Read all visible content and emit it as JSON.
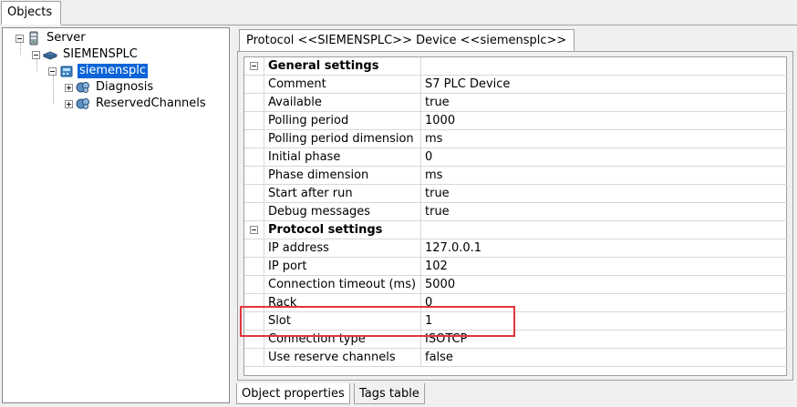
{
  "top_tab": {
    "label": "Objects"
  },
  "tree": {
    "nodes": [
      {
        "label": "Server",
        "expanded": true
      },
      {
        "label": "SIEMENSPLC",
        "expanded": true
      },
      {
        "label": "siemensplc",
        "expanded": true,
        "selected": true
      },
      {
        "label": "Diagnosis",
        "expanded": false
      },
      {
        "label": "ReservedChannels",
        "expanded": false
      }
    ]
  },
  "protocol_tab": {
    "label": "Protocol <<SIEMENSPLC>> Device <<siemensplc>>"
  },
  "properties": {
    "general_header": "General settings",
    "general": [
      {
        "name": "Comment",
        "value": "S7 PLC Device"
      },
      {
        "name": "Available",
        "value": "true"
      },
      {
        "name": "Polling period",
        "value": "1000"
      },
      {
        "name": "Polling period dimension",
        "value": "ms"
      },
      {
        "name": "Initial phase",
        "value": "0"
      },
      {
        "name": "Phase dimension",
        "value": "ms"
      },
      {
        "name": "Start after run",
        "value": "true"
      },
      {
        "name": "Debug messages",
        "value": "true"
      }
    ],
    "protocol_header": "Protocol settings",
    "protocol": [
      {
        "name": "IP address",
        "value": "127.0.0.1"
      },
      {
        "name": "IP port",
        "value": "102"
      },
      {
        "name": "Connection timeout (ms)",
        "value": "5000"
      },
      {
        "name": "Rack",
        "value": "0"
      },
      {
        "name": "Slot",
        "value": "1"
      },
      {
        "name": "Connection type",
        "value": "ISOTCP"
      },
      {
        "name": "Use reserve channels",
        "value": "false"
      }
    ]
  },
  "bottom_tabs": [
    {
      "label": "Object properties",
      "active": true
    },
    {
      "label": "Tags table",
      "active": false
    }
  ],
  "colors": {
    "selection": "#0a64d8",
    "highlight_box": "#e2353d"
  }
}
